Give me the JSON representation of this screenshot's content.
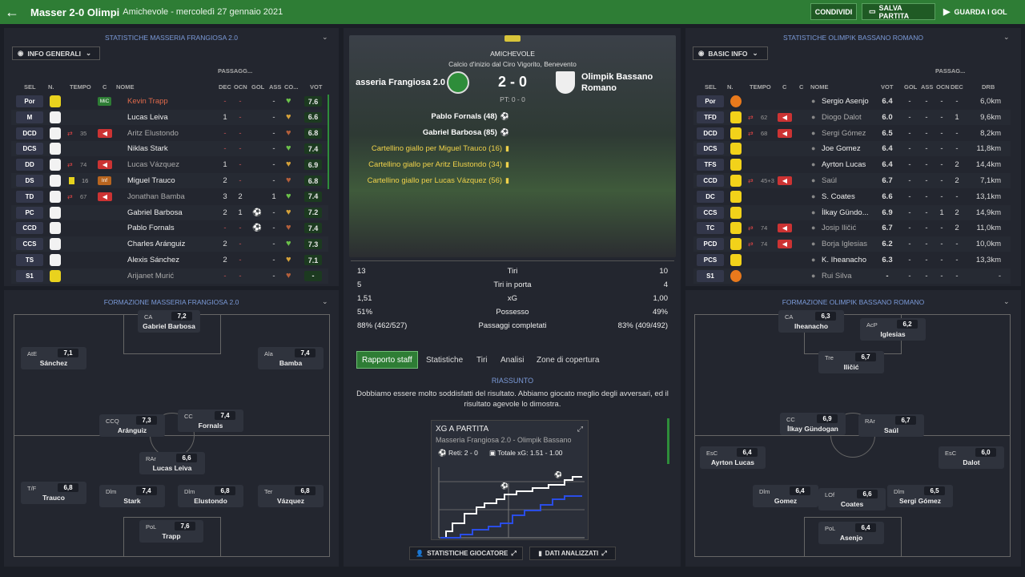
{
  "header": {
    "title": "Masser 2-0 Olimpi",
    "subtitle": "Amichevole - mercoledì 27 gennaio 2021",
    "share": "CONDIVIDI",
    "save": "SALVA PARTITA",
    "watch": "GUARDA I GOL"
  },
  "left": {
    "stats_title": "STATISTICHE MASSERIA FRANGIOSA 2.0",
    "dropdown": "INFO GENERALI",
    "group_header": "PASSAGG...",
    "columns": [
      "SEL",
      "N.",
      "TEMPO",
      "C",
      "NOME",
      "DEC",
      "OCN",
      "GOL",
      "ASS",
      "CO...",
      "VOT"
    ],
    "rows": [
      {
        "pos": "Por",
        "name": "Kevin Trapp",
        "dec": "-",
        "ocn": "-",
        "gol": "",
        "ass": "-",
        "vot": "7.6",
        "kit": "yellow",
        "badge": "MiC",
        "tempo": "",
        "num": "",
        "red": false
      },
      {
        "pos": "M",
        "name": "Lucas Leiva",
        "dec": "1",
        "ocn": "-",
        "gol": "",
        "ass": "-",
        "vot": "6.6",
        "kit": "green",
        "badge": "",
        "tempo": "",
        "num": "",
        "red": false
      },
      {
        "pos": "DCD",
        "name": "Aritz Elustondo",
        "dec": "-",
        "ocn": "-",
        "gol": "",
        "ass": "-",
        "vot": "6.8",
        "kit": "green",
        "badge": "",
        "tempo": "35",
        "num": "",
        "red": true
      },
      {
        "pos": "DCS",
        "name": "Niklas Stark",
        "dec": "-",
        "ocn": "-",
        "gol": "",
        "ass": "-",
        "vot": "7.4",
        "kit": "green",
        "badge": "",
        "tempo": "",
        "num": "",
        "red": false
      },
      {
        "pos": "DD",
        "name": "Lucas Vázquez",
        "dec": "1",
        "ocn": "-",
        "gol": "",
        "ass": "-",
        "vot": "6.9",
        "kit": "green",
        "badge": "",
        "tempo": "74",
        "num": "",
        "red": true
      },
      {
        "pos": "DS",
        "name": "Miguel Trauco",
        "dec": "2",
        "ocn": "-",
        "gol": "",
        "ass": "-",
        "vot": "6.8",
        "kit": "green",
        "badge": "Inf",
        "tempo": "",
        "num": "16",
        "red": false
      },
      {
        "pos": "TD",
        "name": "Jonathan Bamba",
        "dec": "3",
        "ocn": "2",
        "gol": "",
        "ass": "1",
        "vot": "7.4",
        "kit": "green",
        "badge": "",
        "tempo": "67",
        "num": "",
        "red": true
      },
      {
        "pos": "PC",
        "name": "Gabriel Barbosa",
        "dec": "2",
        "ocn": "1",
        "gol": "⚽",
        "ass": "-",
        "vot": "7.2",
        "kit": "green",
        "badge": "",
        "tempo": "",
        "num": "",
        "red": false
      },
      {
        "pos": "CCD",
        "name": "Pablo Fornals",
        "dec": "-",
        "ocn": "-",
        "gol": "⚽",
        "ass": "-",
        "vot": "7.4",
        "kit": "green",
        "badge": "",
        "tempo": "",
        "num": "",
        "red": false
      },
      {
        "pos": "CCS",
        "name": "Charles Aránguiz",
        "dec": "2",
        "ocn": "-",
        "gol": "",
        "ass": "-",
        "vot": "7.3",
        "kit": "green",
        "badge": "",
        "tempo": "",
        "num": "",
        "red": false
      },
      {
        "pos": "TS",
        "name": "Alexis Sánchez",
        "dec": "2",
        "ocn": "-",
        "gol": "",
        "ass": "-",
        "vot": "7.1",
        "kit": "green",
        "badge": "",
        "tempo": "",
        "num": "",
        "red": false
      },
      {
        "pos": "S1",
        "name": "Arijanet Murić",
        "dec": "-",
        "ocn": "-",
        "gol": "",
        "ass": "-",
        "vot": "-",
        "kit": "yellow",
        "badge": "",
        "tempo": "",
        "num": "",
        "red": false
      }
    ],
    "formation_title": "FORMAZIONE MASSERIA FRANGIOSA 2.0",
    "formation": [
      {
        "pos": "CA",
        "rat": "7,2",
        "name": "Gabriel Barbosa"
      },
      {
        "pos": "AtE",
        "rat": "7,1",
        "name": "Sánchez"
      },
      {
        "pos": "Ala",
        "rat": "7,4",
        "name": "Bamba"
      },
      {
        "pos": "CCQ",
        "rat": "7,3",
        "name": "Aránguiz"
      },
      {
        "pos": "CC",
        "rat": "7,4",
        "name": "Fornals"
      },
      {
        "pos": "RAr",
        "rat": "6,6",
        "name": "Lucas Leiva"
      },
      {
        "pos": "T/F",
        "rat": "6,8",
        "name": "Trauco"
      },
      {
        "pos": "Dlm",
        "rat": "7,4",
        "name": "Stark"
      },
      {
        "pos": "Dlm",
        "rat": "6,8",
        "name": "Elustondo"
      },
      {
        "pos": "Ter",
        "rat": "6,8",
        "name": "Vázquez"
      },
      {
        "pos": "PoL",
        "rat": "7,6",
        "name": "Trapp"
      }
    ]
  },
  "center": {
    "competition": "AMICHEVOLE",
    "kickoff": "Calcio d'inizio dal Ciro Vigorito, Benevento",
    "home": "asseria Frangiosa 2.0",
    "away_line1": "Olimpik Bassano",
    "away_line2": "Romano",
    "score": "2 - 0",
    "pt": "PT: 0 - 0",
    "events": [
      "Pablo Fornals (48)",
      "Gabriel Barbosa (85)",
      "Cartellino giallo per Miguel Trauco (16)",
      "Cartellino giallo per Aritz Elustondo (34)",
      "Cartellino giallo per Lucas Vázquez (56)"
    ],
    "stats": [
      {
        "l": "13",
        "label": "Tiri",
        "r": "10"
      },
      {
        "l": "5",
        "label": "Tiri in porta",
        "r": "4"
      },
      {
        "l": "1,51",
        "label": "xG",
        "r": "1,00"
      },
      {
        "l": "51%",
        "label": "Possesso",
        "r": "49%"
      },
      {
        "l": "88% (462/527)",
        "label": "Passaggi completati",
        "r": "83% (409/492)"
      }
    ],
    "tabs": [
      "Rapporto staff",
      "Statistiche",
      "Tiri",
      "Analisi",
      "Zone di copertura"
    ],
    "summary_title": "RIASSUNTO",
    "summary_text": "Dobbiamo essere molto soddisfatti del risultato. Abbiamo giocato meglio degli avversari, ed il risultato agevole lo dimostra.",
    "xg_title": "XG A PARTITA",
    "xg_sub": "Masseria Frangiosa 2.0 - Olimpik Bassano",
    "xg_goals": "Reti: 2 - 0",
    "xg_total": "Totale xG: 1.51 - 1.00",
    "btn_players": "STATISTICHE GIOCATORE",
    "btn_data": "DATI ANALIZZATI"
  },
  "right": {
    "stats_title": "STATISTICHE OLIMPIK BASSANO ROMANO",
    "dropdown": "BASIC INFO",
    "group_header": "PASSAG...",
    "columns": [
      "SEL",
      "N.",
      "TEMPO",
      "C",
      "C",
      "NOME",
      "VOT",
      "GOL",
      "ASS",
      "OCN",
      "DEC",
      "DRB"
    ],
    "rows": [
      {
        "pos": "Por",
        "name": "Sergio Asenjo",
        "vot": "6.4",
        "gol": "-",
        "ass": "-",
        "ocn": "-",
        "dec": "-",
        "drb": "6,0km",
        "kit": "orange",
        "tempo": "",
        "red": false
      },
      {
        "pos": "TFD",
        "name": "Diogo Dalot",
        "vot": "6.0",
        "gol": "-",
        "ass": "-",
        "ocn": "-",
        "dec": "1",
        "drb": "9,6km",
        "kit": "blue",
        "tempo": "62",
        "red": true
      },
      {
        "pos": "DCD",
        "name": "Sergi Gómez",
        "vot": "6.5",
        "gol": "-",
        "ass": "-",
        "ocn": "-",
        "dec": "-",
        "drb": "8,2km",
        "kit": "blue",
        "tempo": "68",
        "red": true
      },
      {
        "pos": "DCS",
        "name": "Joe Gomez",
        "vot": "6.4",
        "gol": "-",
        "ass": "-",
        "ocn": "-",
        "dec": "-",
        "drb": "11,8km",
        "kit": "blue",
        "tempo": "",
        "red": false
      },
      {
        "pos": "TFS",
        "name": "Ayrton Lucas",
        "vot": "6.4",
        "gol": "-",
        "ass": "-",
        "ocn": "-",
        "dec": "2",
        "drb": "14,4km",
        "kit": "blue",
        "tempo": "",
        "red": false
      },
      {
        "pos": "CCD",
        "name": "Saúl",
        "vot": "6.7",
        "gol": "-",
        "ass": "-",
        "ocn": "-",
        "dec": "2",
        "drb": "7,1km",
        "kit": "blue",
        "tempo": "45+3",
        "red": true
      },
      {
        "pos": "DC",
        "name": "S. Coates",
        "vot": "6.6",
        "gol": "-",
        "ass": "-",
        "ocn": "-",
        "dec": "-",
        "drb": "13,1km",
        "kit": "blue",
        "tempo": "",
        "red": false
      },
      {
        "pos": "CCS",
        "name": "İlkay Gündo...",
        "vot": "6.9",
        "gol": "-",
        "ass": "-",
        "ocn": "1",
        "dec": "2",
        "drb": "14,9km",
        "kit": "blue",
        "tempo": "",
        "red": false
      },
      {
        "pos": "TC",
        "name": "Josip Iličić",
        "vot": "6.7",
        "gol": "-",
        "ass": "-",
        "ocn": "-",
        "dec": "2",
        "drb": "11,0km",
        "kit": "blue",
        "tempo": "74",
        "red": true
      },
      {
        "pos": "PCD",
        "name": "Borja Iglesias",
        "vot": "6.2",
        "gol": "-",
        "ass": "-",
        "ocn": "-",
        "dec": "-",
        "drb": "10,0km",
        "kit": "blue",
        "tempo": "74",
        "red": true
      },
      {
        "pos": "PCS",
        "name": "K. Iheanacho",
        "vot": "6.3",
        "gol": "-",
        "ass": "-",
        "ocn": "-",
        "dec": "-",
        "drb": "13,3km",
        "kit": "blue",
        "tempo": "",
        "red": false
      },
      {
        "pos": "S1",
        "name": "Rui Silva",
        "vot": "-",
        "gol": "-",
        "ass": "-",
        "ocn": "-",
        "dec": "-",
        "drb": "-",
        "kit": "orange",
        "tempo": "",
        "red": false
      }
    ],
    "formation_title": "FORMAZIONE OLIMPIK BASSANO ROMANO",
    "formation": [
      {
        "pos": "CA",
        "rat": "6,3",
        "name": "Iheanacho"
      },
      {
        "pos": "AcP",
        "rat": "6,2",
        "name": "Iglesias"
      },
      {
        "pos": "Tre",
        "rat": "6,7",
        "name": "Iličić"
      },
      {
        "pos": "CC",
        "rat": "6,9",
        "name": "İlkay Gündogan"
      },
      {
        "pos": "RAr",
        "rat": "6,7",
        "name": "Saúl"
      },
      {
        "pos": "EsC",
        "rat": "6,4",
        "name": "Ayrton Lucas"
      },
      {
        "pos": "EsC",
        "rat": "6,0",
        "name": "Dalot"
      },
      {
        "pos": "Dlm",
        "rat": "6,4",
        "name": "Gomez"
      },
      {
        "pos": "LOf",
        "rat": "6,6",
        "name": "Coates"
      },
      {
        "pos": "Dlm",
        "rat": "6,5",
        "name": "Sergi Gómez"
      },
      {
        "pos": "PoL",
        "rat": "6,4",
        "name": "Asenjo"
      }
    ]
  }
}
